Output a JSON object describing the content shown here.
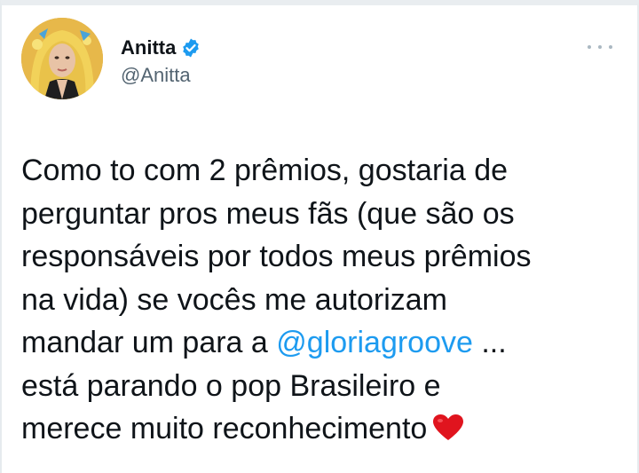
{
  "tweet": {
    "author": {
      "display_name": "Anitta",
      "handle": "@Anitta",
      "verified": true,
      "avatar_icon": "avatar-photo"
    },
    "more_icon": "more-icon",
    "text_before_mention": "Como to com 2 prêmios, gostaria de\nperguntar pros meus fãs (que são os\nresponsáveis por todos meus prêmios\nna vida) se vocês me autorizam\nmandar um para a ",
    "mention": "@gloriagroove",
    "text_after_mention": " ...\nestá parando o pop Brasileiro e\nmerece muito reconhecimento",
    "emoji": "heart-icon"
  },
  "colors": {
    "mention": "#1d9bf0",
    "verified_badge": "#1d9bf0",
    "heart": "#e0141e",
    "handle": "#536471"
  }
}
